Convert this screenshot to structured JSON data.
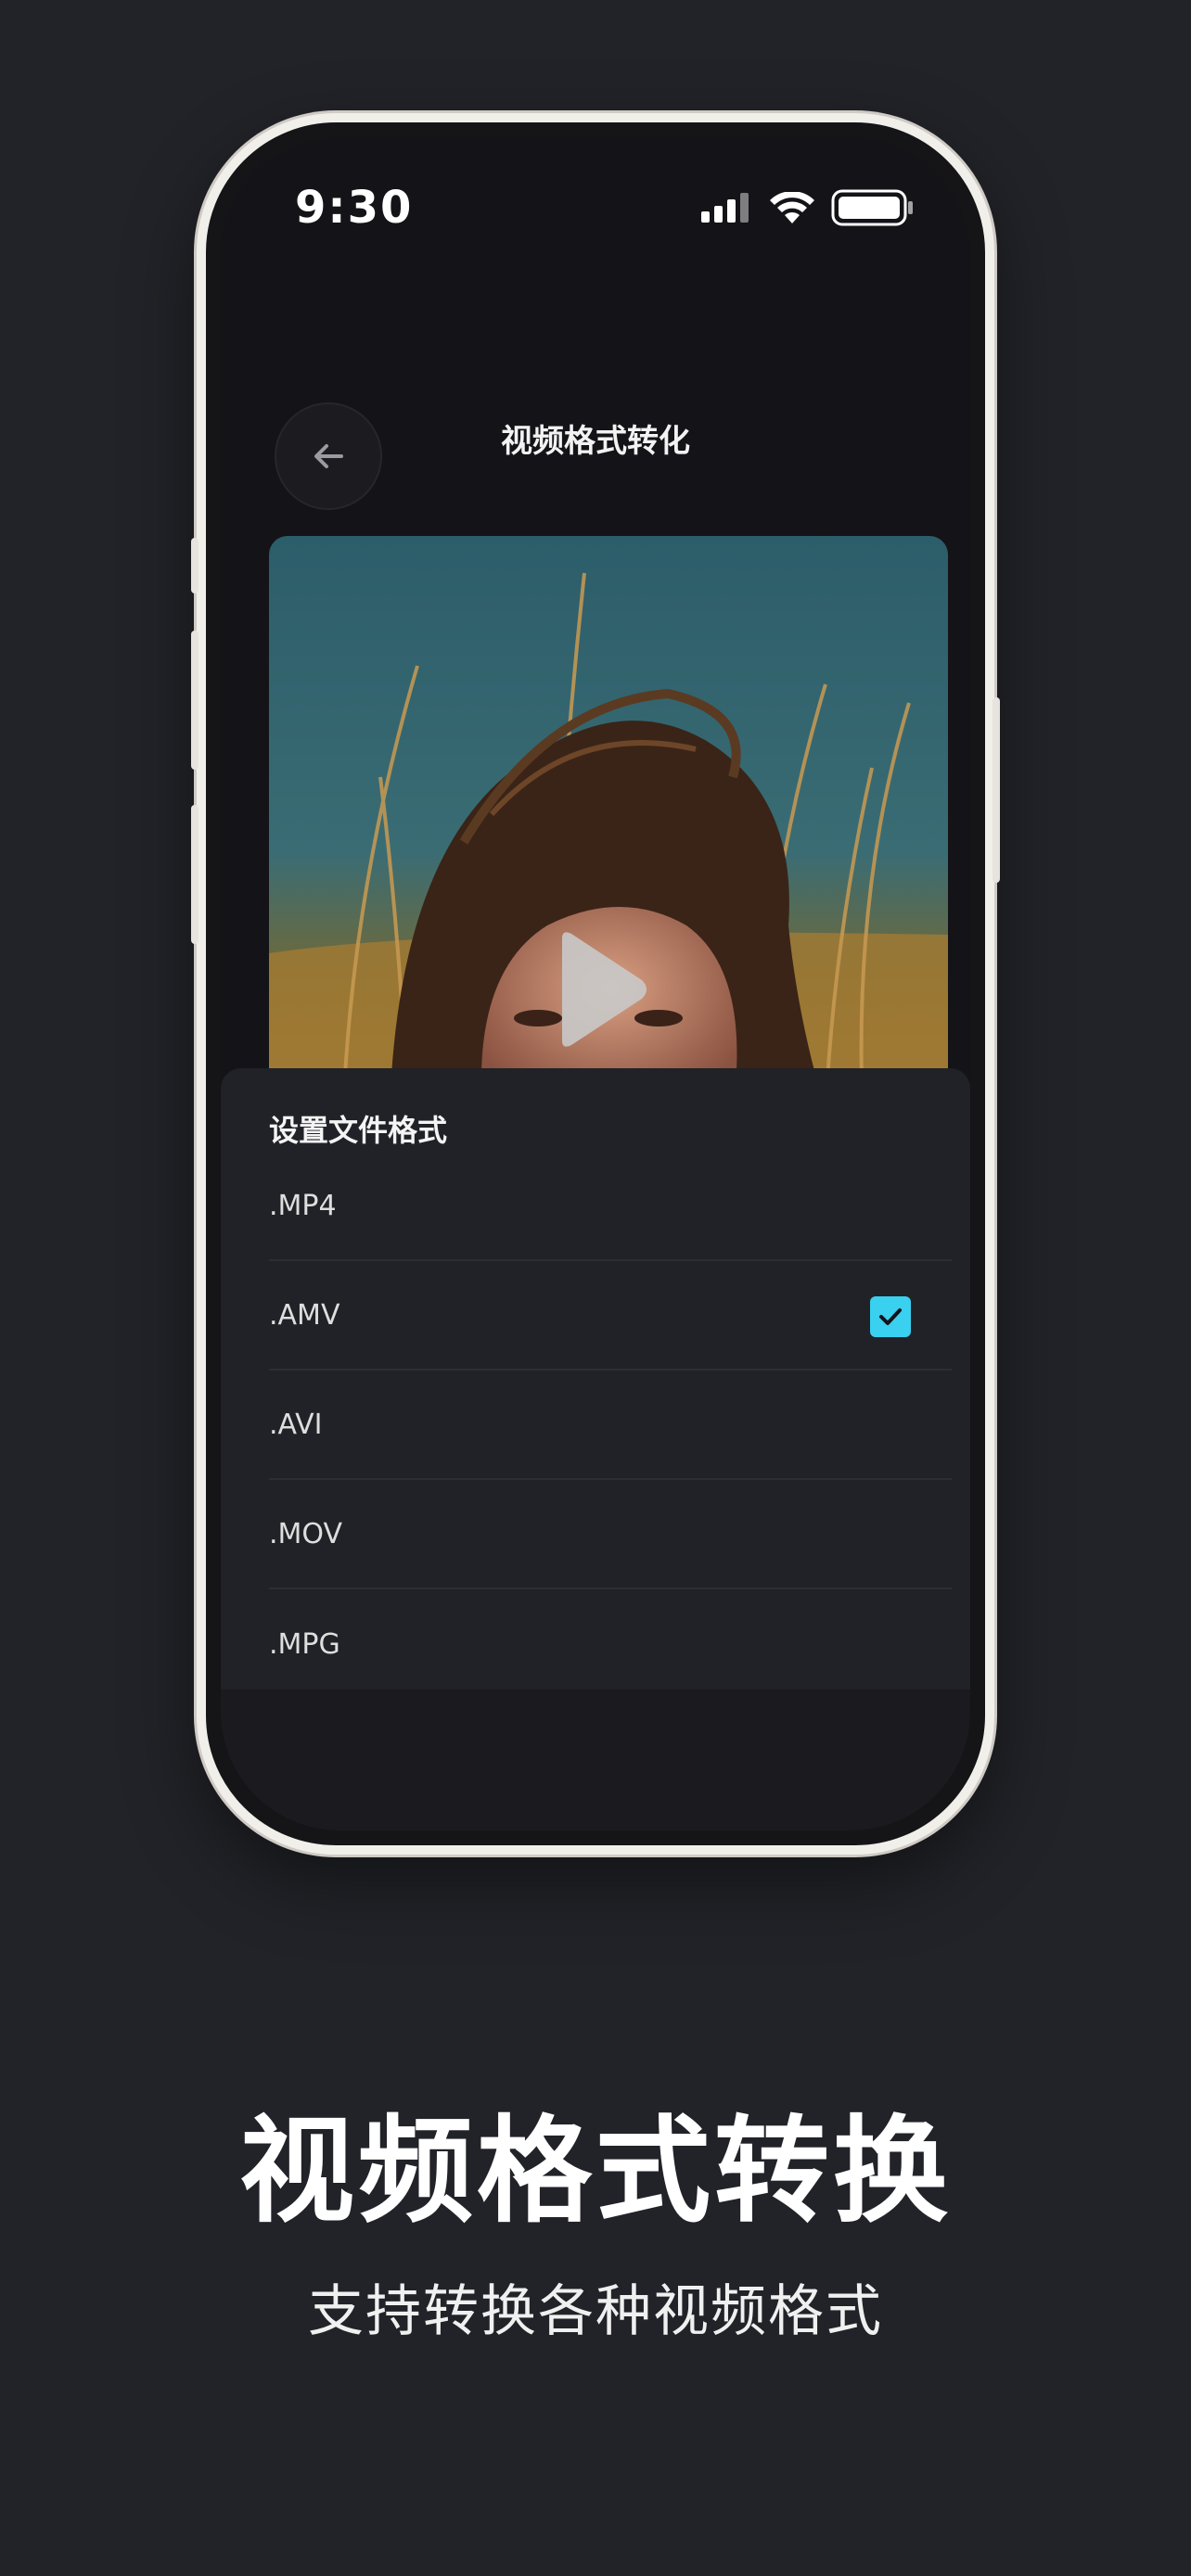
{
  "status_bar": {
    "time": "9:30"
  },
  "nav": {
    "title": "视频格式转化"
  },
  "sheet": {
    "title": "设置文件格式",
    "formats": [
      {
        "label": ".MP4",
        "selected": false
      },
      {
        "label": ".AMV",
        "selected": true
      },
      {
        "label": ".AVI",
        "selected": false
      },
      {
        "label": ".MOV",
        "selected": false
      },
      {
        "label": ".MPG",
        "selected": false
      }
    ]
  },
  "promo": {
    "title": "视频格式转换",
    "subtitle": "支持转换各种视频格式"
  },
  "colors": {
    "background": "#222328",
    "accent_check": "#3ad0f0",
    "sheet": "#212227"
  }
}
